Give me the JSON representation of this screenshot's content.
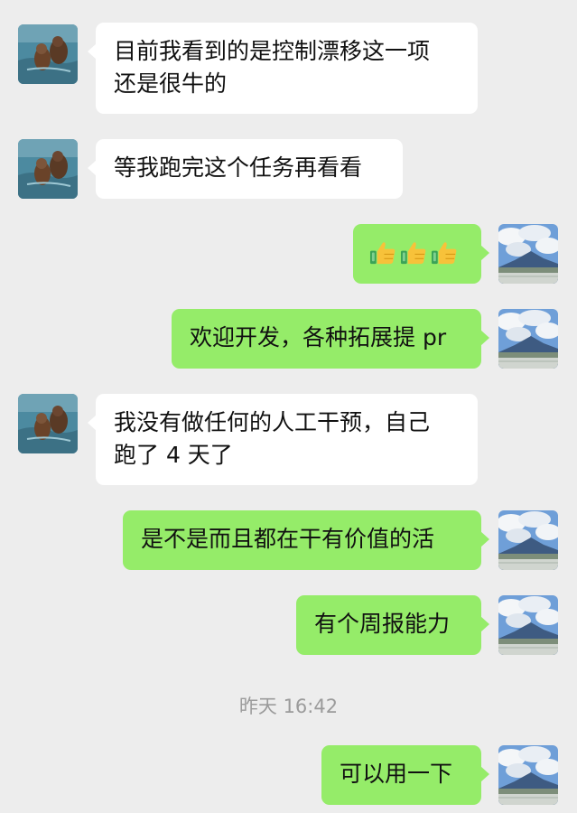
{
  "messages": [
    {
      "side": "left",
      "lines": [
        "目前我看到的是控制漂移这一项",
        "还是很牛的"
      ]
    },
    {
      "side": "left",
      "lines": [
        "等我跑完这个任务再看看"
      ]
    },
    {
      "side": "right",
      "emoji": [
        "thumbs-up",
        "thumbs-up",
        "thumbs-up"
      ]
    },
    {
      "side": "right",
      "lines": [
        "欢迎开发，各种拓展提 pr"
      ]
    },
    {
      "side": "left",
      "lines": [
        "我没有做任何的人工干预，自己",
        "跑了 4 天了"
      ]
    },
    {
      "side": "right",
      "lines": [
        "是不是而且都在干有价值的活"
      ]
    },
    {
      "side": "right",
      "lines": [
        "有个周报能力"
      ]
    },
    {
      "side": "right",
      "lines": [
        "可以用一下"
      ]
    }
  ],
  "timestamp": "昨天 16:42",
  "colors": {
    "background": "#ededed",
    "incoming_bubble": "#ffffff",
    "outgoing_bubble": "#95ec69",
    "timestamp_text": "#9b9b9b"
  },
  "icons": {
    "left_avatar": "otter-photo-avatar",
    "right_avatar": "mountain-landscape-avatar",
    "emoji": "thumbs-up-emoji"
  }
}
